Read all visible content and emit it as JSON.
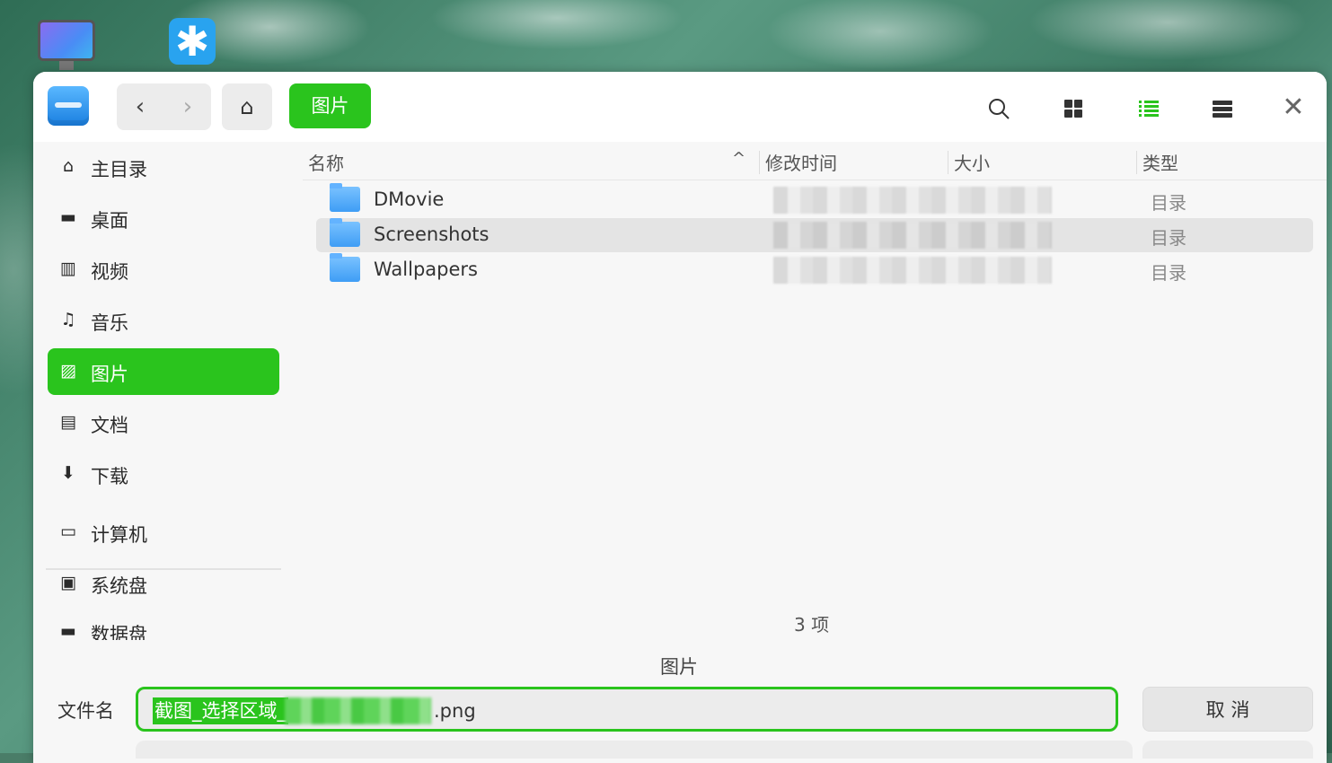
{
  "toolbar": {
    "back_icon": "‹",
    "forward_icon": "›",
    "home_icon": "⌂",
    "breadcrumb": "图片",
    "search_icon": "⚲",
    "close_icon": "✕"
  },
  "sidebar": {
    "items": [
      {
        "label": "主目录",
        "icon": "⌂",
        "icon_name": "home-icon"
      },
      {
        "label": "桌面",
        "icon": "▬",
        "icon_name": "desktop-icon"
      },
      {
        "label": "视频",
        "icon": "▥",
        "icon_name": "video-icon"
      },
      {
        "label": "音乐",
        "icon": "♫",
        "icon_name": "music-icon"
      },
      {
        "label": "图片",
        "icon": "▨",
        "icon_name": "pictures-icon",
        "active": true
      },
      {
        "label": "文档",
        "icon": "▤",
        "icon_name": "document-icon"
      },
      {
        "label": "下载",
        "icon": "⬇",
        "icon_name": "download-icon"
      },
      {
        "label": "计算机",
        "icon": "▭",
        "icon_name": "computer-icon"
      },
      {
        "label": "系统盘",
        "icon": "▣",
        "icon_name": "system-disk-icon"
      },
      {
        "label": "数据盘",
        "icon": "▬",
        "icon_name": "data-disk-icon"
      }
    ]
  },
  "columns": {
    "name": "名称",
    "modified": "修改时间",
    "size": "大小",
    "type": "类型",
    "sort_icon": "^"
  },
  "files": [
    {
      "name": "DMovie",
      "type": "目录"
    },
    {
      "name": "Screenshots",
      "type": "目录",
      "selected": true
    },
    {
      "name": "Wallpapers",
      "type": "目录"
    }
  ],
  "item_count": "3 项",
  "footer": {
    "current_folder": "图片",
    "filename_label": "文件名",
    "filename_selected": "截图_选择区域_",
    "filename_suffix": ".png",
    "cancel_label": "取 消"
  },
  "colors": {
    "accent": "#2ac41d",
    "folder": "#4aa6f7"
  },
  "desktop": {
    "app_icon": "✱"
  }
}
